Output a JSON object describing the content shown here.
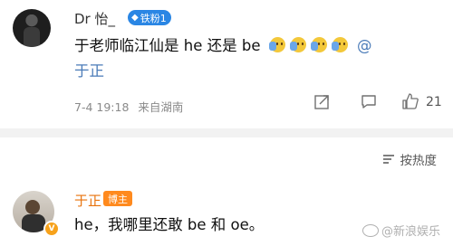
{
  "comment1": {
    "username": "Dr 怡_",
    "fan_badge": "铁粉1",
    "text": "于老师临江仙是 he 还是 be",
    "emoji_name": "smirk-hand-emoji",
    "emoji_count": 4,
    "at_symbol": "@",
    "mention": "于正",
    "time": "7-4 19:18",
    "location": "来自湖南",
    "like_count": "21"
  },
  "sort": {
    "label": "按热度"
  },
  "comment2": {
    "username": "于正",
    "badge": "博主",
    "text": "he，我哪里还敢 be 和 oe。",
    "verified_mark": "V"
  },
  "watermark": {
    "text": "@新浪娱乐"
  },
  "colors": {
    "accent_blue": "#4a7bb8",
    "orange": "#e8720c",
    "fan_badge_bg": "#2a86e4"
  }
}
